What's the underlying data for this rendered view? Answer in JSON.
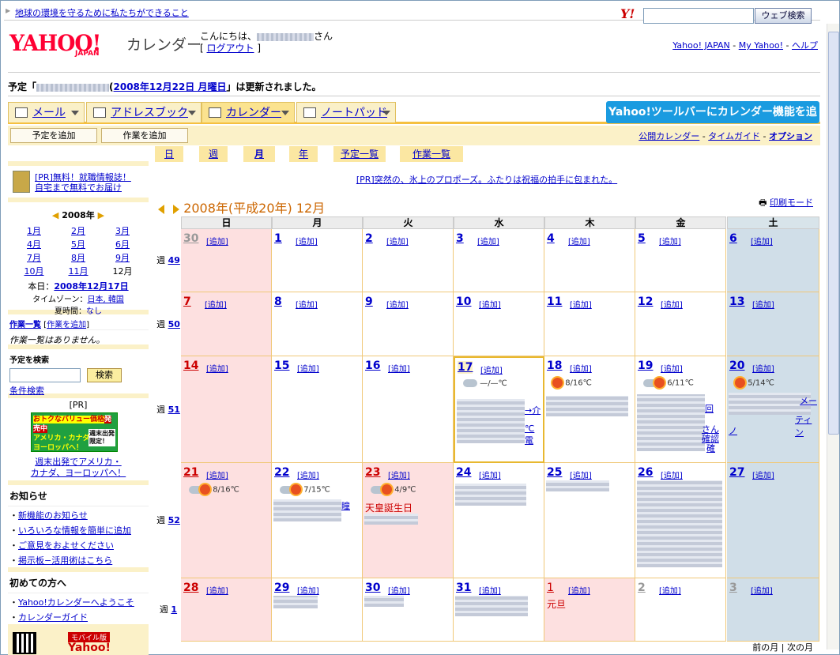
{
  "top": {
    "env_link": "地球の環境を守るために私たちができること",
    "search_btn": "ウェブ検索",
    "y_logo": "Y!"
  },
  "header": {
    "logo": "YAHOO!",
    "logo_sub": "JAPAN",
    "app": "カレンダー",
    "greet_pre": "こんにちは、",
    "greet_post": "さん",
    "logout": "ログアウト",
    "links": [
      "Yahoo! JAPAN",
      "My Yahoo!",
      "ヘルプ"
    ]
  },
  "notice": {
    "pre": "予定「",
    "date": "2008年12月22日 月曜日",
    "post": "」は更新されました。"
  },
  "tabs": [
    {
      "label": "メール"
    },
    {
      "label": "アドレスブック"
    },
    {
      "label": "カレンダー"
    },
    {
      "label": "ノートパッド"
    }
  ],
  "toolbar_add": "Yahoo!ツールバーにカレンダー機能を追加",
  "sub": {
    "add_event": "予定を追加",
    "add_task": "作業を追加",
    "links": [
      "公開カレンダー",
      "タイムガイド",
      "オプション"
    ]
  },
  "views": [
    "日",
    "週",
    "月",
    "年",
    "予定一覧",
    "作業一覧"
  ],
  "pr": {
    "text": "[PR]突然の、氷上のプロポーズ。ふたりは祝福の拍手に包まれた。"
  },
  "month": {
    "title": "2008年(平成20年) 12月",
    "print": "印刷モード"
  },
  "weekdays": [
    "日",
    "月",
    "火",
    "水",
    "木",
    "金",
    "土"
  ],
  "weeks": [
    {
      "label": "週",
      "num": "49",
      "days": [
        "30",
        "1",
        "2",
        "3",
        "4",
        "5",
        "6"
      ]
    },
    {
      "label": "週",
      "num": "50",
      "days": [
        "7",
        "8",
        "9",
        "10",
        "11",
        "12",
        "13"
      ]
    },
    {
      "label": "週",
      "num": "51",
      "days": [
        "14",
        "15",
        "16",
        "17",
        "18",
        "19",
        "20"
      ]
    },
    {
      "label": "週",
      "num": "52",
      "days": [
        "21",
        "22",
        "23",
        "24",
        "25",
        "26",
        "27"
      ]
    },
    {
      "label": "週",
      "num": "1",
      "days": [
        "28",
        "29",
        "30",
        "31",
        "1",
        "2",
        "3"
      ]
    }
  ],
  "add_label": "[追加]",
  "weather": {
    "w17": "—/—℃",
    "w18": "8/16℃",
    "w19": "6/11℃",
    "w20": "5/14℃",
    "w21": "8/16℃",
    "w22": "7/15℃",
    "w23": "4/9℃"
  },
  "holidays": {
    "d23": "天皇誕生日",
    "d1": "元旦"
  },
  "snippets": {
    "a": "→介",
    "b": "℃電",
    "c": "回",
    "d": "さん",
    "e": "確認",
    "f": "確",
    "g": "メー",
    "h": "ティン",
    "i": "ノ",
    "j": "瞳",
    "k": "瞳"
  },
  "sidebar": {
    "pr_line1": "[PR]無料！就職情報誌！",
    "pr_line2": "自宅まで無料でお届け",
    "year": "2008年",
    "months": [
      "1月",
      "2月",
      "3月",
      "4月",
      "5月",
      "6月",
      "7月",
      "8月",
      "9月",
      "10月",
      "11月",
      "12月"
    ],
    "today_label": "本日：",
    "today": "2008年12月17日",
    "tz_label": "タイムゾーン：",
    "tz": "日本, 韓国",
    "dst_label": "夏時間：",
    "dst": "なし",
    "tasks_title": "作業一覧",
    "tasks_add": "作業を追加",
    "tasks_empty": "作業一覧はありません。",
    "search_title": "予定を検索",
    "search_btn": "検索",
    "cond_search": "条件検索",
    "pr2": "[PR]",
    "ad_line1": "週末出発でアメリカ・",
    "ad_line2": "カナダ、ヨーロッパへ！",
    "ad_img": [
      "おトクなバリュー価格",
      "発売中",
      "アメリカ・カナダ・",
      "ヨーロッパへ！",
      "週末出発",
      "限定！"
    ],
    "news_title": "お知らせ",
    "news": [
      "新機能のお知らせ",
      "いろいろな情報を簡単に追加",
      "ご意見をおよせください",
      "掲示板−活用術はこちら"
    ],
    "first_title": "初めての方へ",
    "first": [
      "Yahoo!カレンダーへようこそ",
      "カレンダーガイド"
    ],
    "mobile": "モバイル版",
    "mobile2": "Yahoo!"
  },
  "footer_nav": "前の月 | 次の月"
}
